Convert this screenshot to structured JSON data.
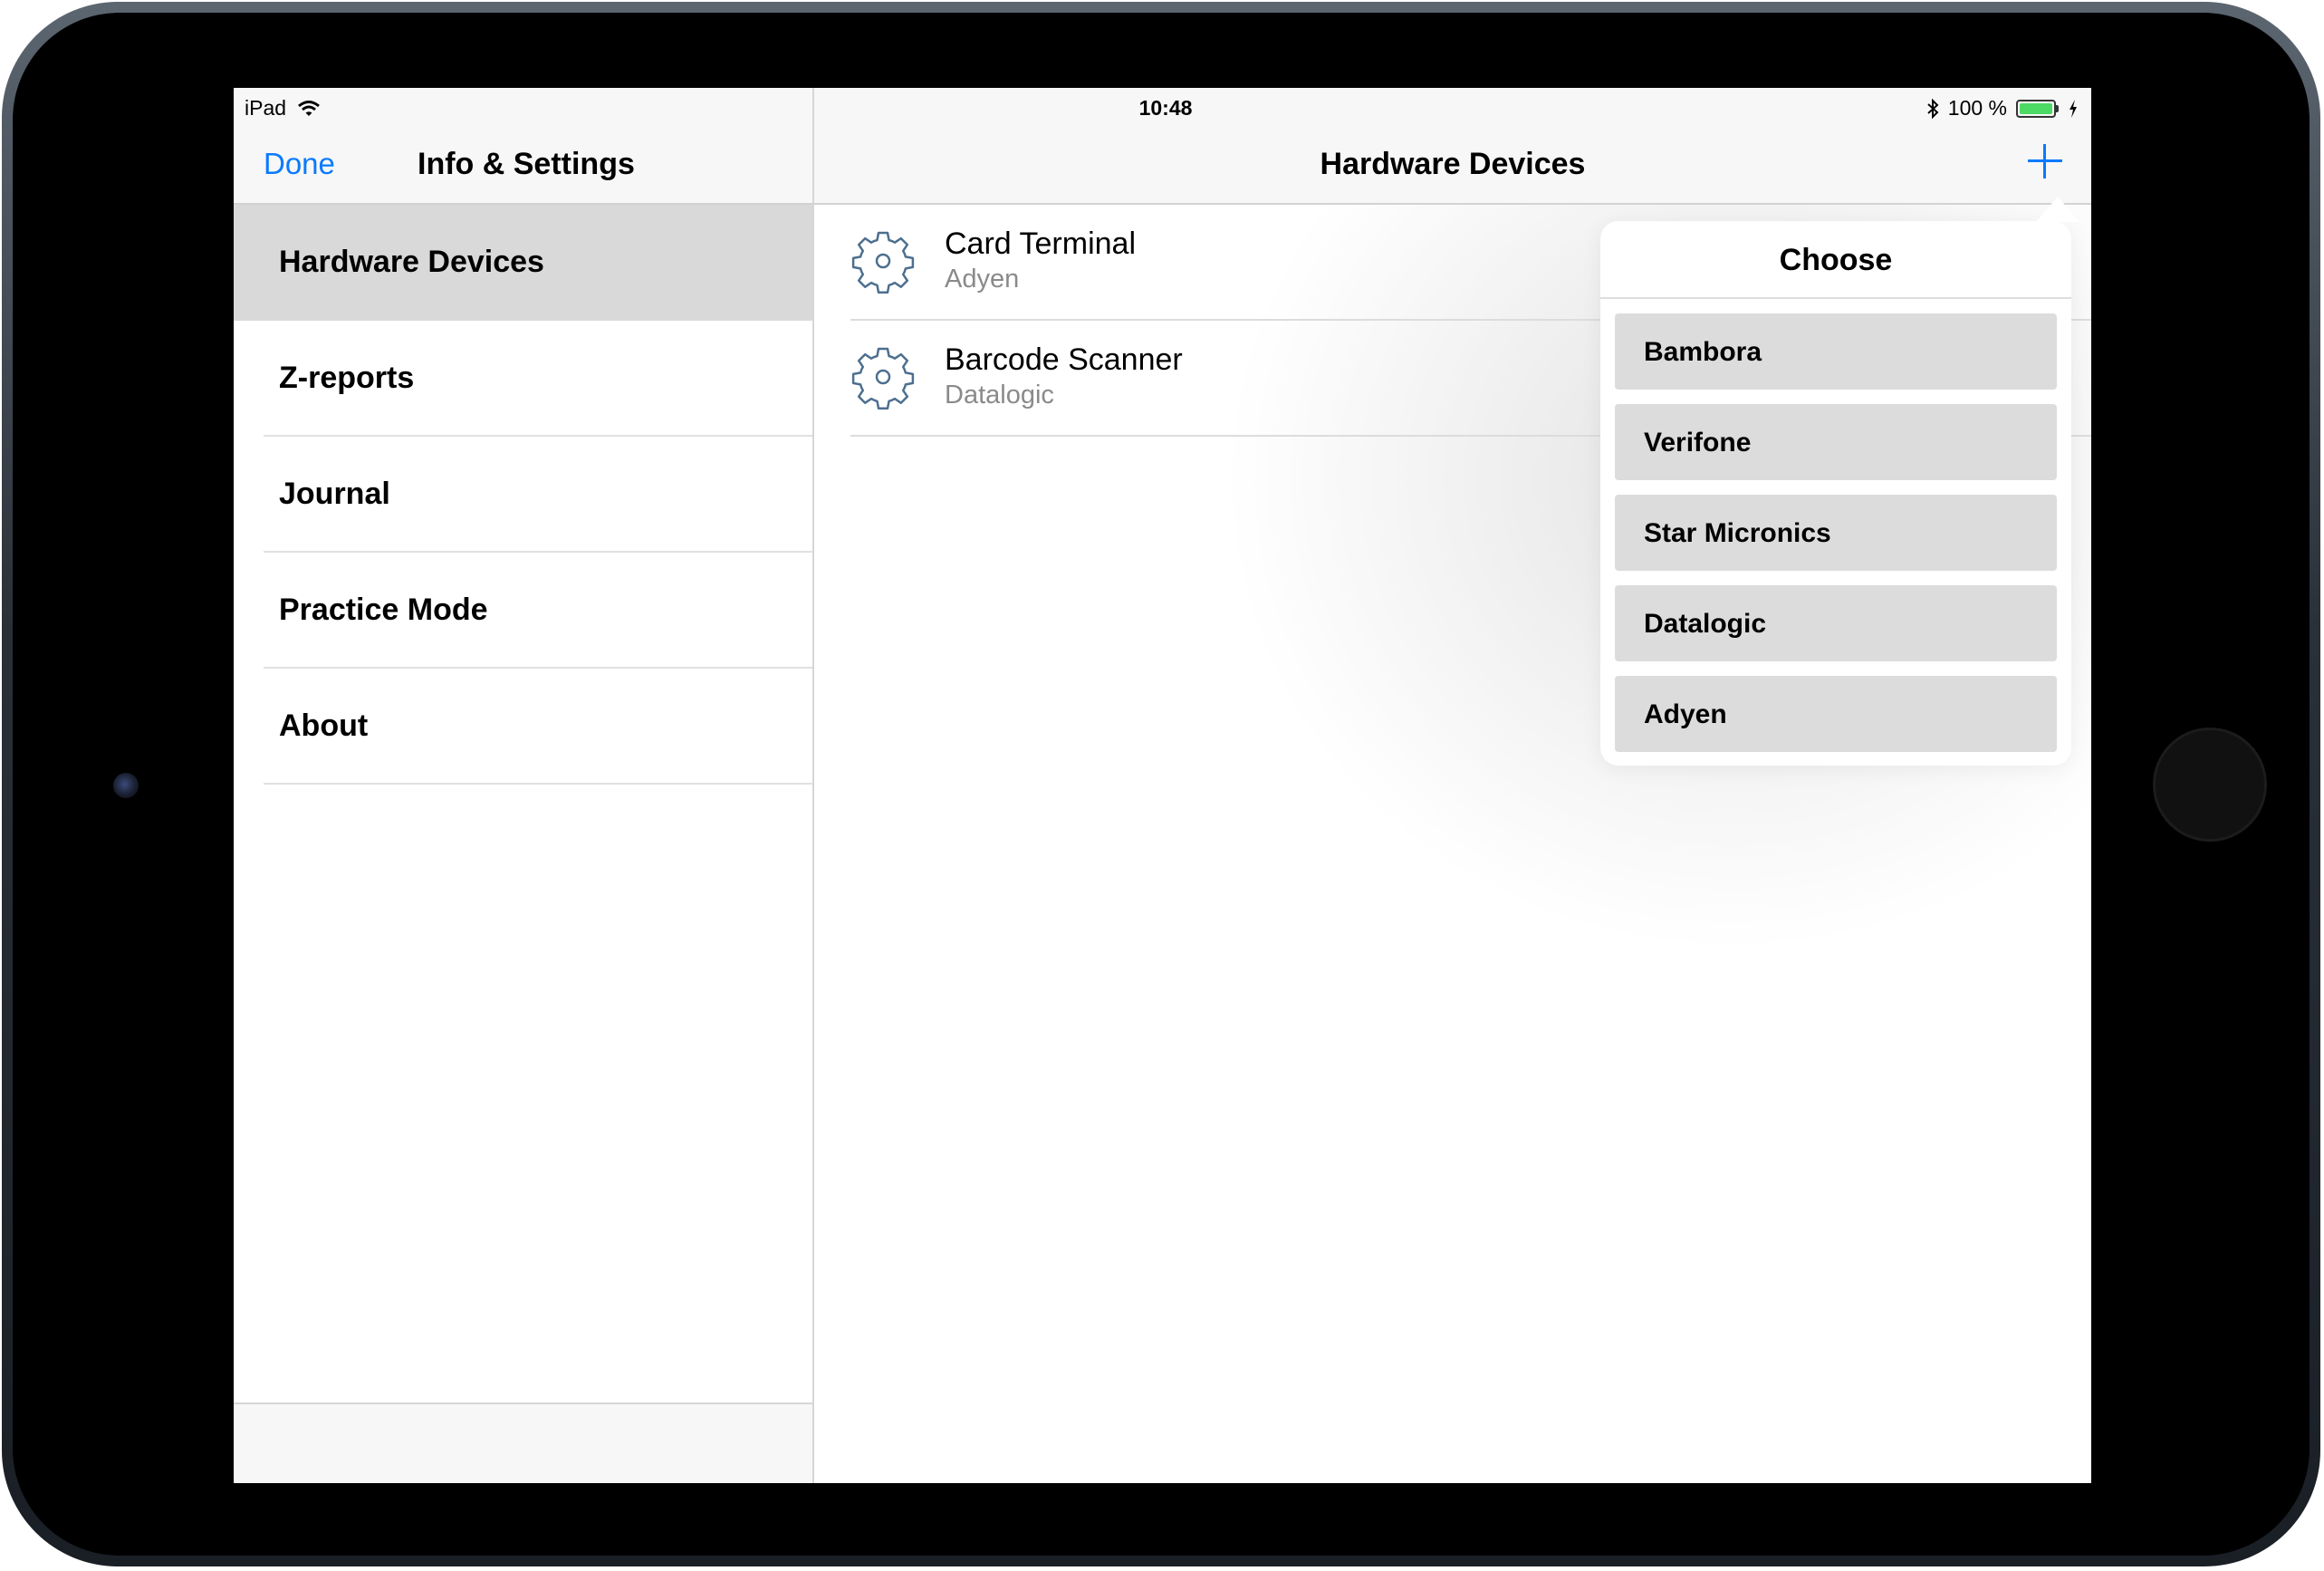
{
  "status_bar": {
    "device": "iPad",
    "time": "10:48",
    "battery_text": "100 %",
    "battery_level": 1.0,
    "icons": [
      "wifi-icon",
      "bluetooth-icon",
      "battery-icon",
      "charging-icon"
    ]
  },
  "master": {
    "done_label": "Done",
    "title": "Info & Settings",
    "items": [
      {
        "label": "Hardware Devices",
        "selected": true
      },
      {
        "label": "Z-reports",
        "selected": false
      },
      {
        "label": "Journal",
        "selected": false
      },
      {
        "label": "Practice Mode",
        "selected": false
      },
      {
        "label": "About",
        "selected": false
      }
    ]
  },
  "detail": {
    "title": "Hardware Devices",
    "add_icon": "plus-icon",
    "devices": [
      {
        "name": "Card Terminal",
        "vendor": "Adyen",
        "icon": "gear-icon"
      },
      {
        "name": "Barcode Scanner",
        "vendor": "Datalogic",
        "icon": "gear-icon"
      }
    ]
  },
  "popover": {
    "title": "Choose",
    "options": [
      "Bambora",
      "Verifone",
      "Star Micronics",
      "Datalogic",
      "Adyen"
    ]
  },
  "colors": {
    "accent": "#0a7aff",
    "selected_row": "#d9d9d9",
    "option_bg": "#dcdcdc",
    "battery": "#4cd964",
    "gear": "#4d6f8f"
  }
}
